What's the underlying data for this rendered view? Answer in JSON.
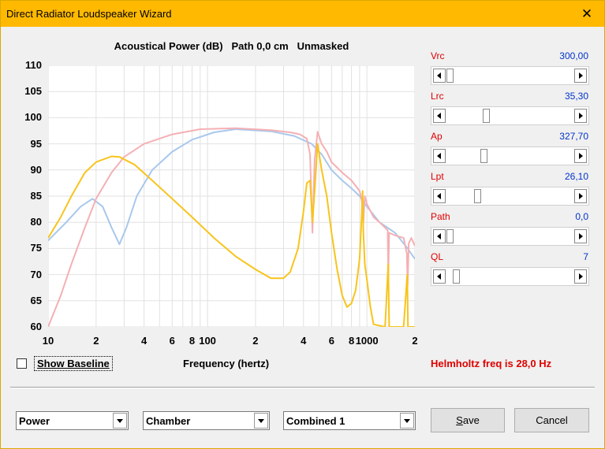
{
  "window": {
    "title": "Direct Radiator Loudspeaker Wizard",
    "close_glyph": "✕"
  },
  "chart_data": {
    "type": "line",
    "title": "Acoustical Power (dB)   Path 0,0 cm   Unmasked",
    "xlabel": "Frequency (hertz)",
    "ylabel": "",
    "x_scale": "log",
    "xlim": [
      10,
      2000
    ],
    "ylim": [
      60,
      110
    ],
    "yticks": [
      110,
      105,
      100,
      95,
      90,
      85,
      80,
      75,
      70,
      65,
      60
    ],
    "xtick_labels": [
      {
        "value": 10,
        "label": "10"
      },
      {
        "value": 20,
        "label": "2"
      },
      {
        "value": 40,
        "label": "4"
      },
      {
        "value": 60,
        "label": "6"
      },
      {
        "value": 80,
        "label": "8"
      },
      {
        "value": 100,
        "label": "100"
      },
      {
        "value": 200,
        "label": "2"
      },
      {
        "value": 400,
        "label": "4"
      },
      {
        "value": 600,
        "label": "6"
      },
      {
        "value": 800,
        "label": "8"
      },
      {
        "value": 1000,
        "label": "1000"
      },
      {
        "value": 2000,
        "label": "2"
      }
    ],
    "grid": true,
    "series": [
      {
        "color": "#a8c8ec",
        "points": [
          [
            10,
            76.5
          ],
          [
            13,
            80
          ],
          [
            16,
            83
          ],
          [
            19,
            84.5
          ],
          [
            22,
            83
          ],
          [
            25,
            79
          ],
          [
            28,
            75.8
          ],
          [
            31,
            79
          ],
          [
            36,
            85
          ],
          [
            45,
            90
          ],
          [
            60,
            93.5
          ],
          [
            80,
            95.8
          ],
          [
            110,
            97.2
          ],
          [
            150,
            97.8
          ],
          [
            250,
            97.4
          ],
          [
            350,
            96.5
          ],
          [
            450,
            95
          ],
          [
            520,
            93
          ],
          [
            600,
            90
          ],
          [
            700,
            88
          ],
          [
            800,
            86.5
          ],
          [
            900,
            85
          ],
          [
            1000,
            83
          ],
          [
            1200,
            80
          ],
          [
            1500,
            78
          ],
          [
            1800,
            75
          ],
          [
            2000,
            73
          ]
        ]
      },
      {
        "color": "#f4b0b4",
        "points": [
          [
            10,
            60
          ],
          [
            12,
            66
          ],
          [
            14,
            72
          ],
          [
            17,
            79
          ],
          [
            20,
            84.5
          ],
          [
            25,
            89.5
          ],
          [
            30,
            92.5
          ],
          [
            40,
            95
          ],
          [
            60,
            96.8
          ],
          [
            90,
            97.8
          ],
          [
            150,
            98
          ],
          [
            250,
            97.6
          ],
          [
            330,
            97.2
          ],
          [
            380,
            96.8
          ],
          [
            420,
            96
          ],
          [
            440,
            93
          ],
          [
            455,
            78
          ],
          [
            470,
            92
          ],
          [
            490,
            97.3
          ],
          [
            520,
            95
          ],
          [
            560,
            93.5
          ],
          [
            600,
            91.5
          ],
          [
            700,
            89.5
          ],
          [
            800,
            88
          ],
          [
            900,
            86
          ],
          [
            930,
            84
          ],
          [
            950,
            80
          ],
          [
            970,
            85
          ],
          [
            1000,
            83.5
          ],
          [
            1100,
            81
          ],
          [
            1200,
            80
          ],
          [
            1350,
            78.5
          ],
          [
            1360,
            70
          ],
          [
            1380,
            78
          ],
          [
            1500,
            77.5
          ],
          [
            1700,
            77
          ],
          [
            1780,
            74
          ],
          [
            1800,
            68
          ],
          [
            1830,
            76
          ],
          [
            1900,
            77
          ],
          [
            2000,
            75.5
          ]
        ]
      },
      {
        "color": "#f8c41c",
        "points": [
          [
            10,
            77
          ],
          [
            12,
            81
          ],
          [
            14,
            85
          ],
          [
            17,
            89.5
          ],
          [
            20,
            91.5
          ],
          [
            25,
            92.6
          ],
          [
            28,
            92.5
          ],
          [
            35,
            91
          ],
          [
            45,
            88
          ],
          [
            60,
            84.5
          ],
          [
            80,
            81
          ],
          [
            110,
            77
          ],
          [
            150,
            73.5
          ],
          [
            200,
            71
          ],
          [
            250,
            69.3
          ],
          [
            300,
            69.3
          ],
          [
            330,
            70.5
          ],
          [
            370,
            75
          ],
          [
            400,
            82
          ],
          [
            420,
            87.5
          ],
          [
            440,
            88
          ],
          [
            455,
            80
          ],
          [
            470,
            86
          ],
          [
            490,
            95
          ],
          [
            520,
            90
          ],
          [
            560,
            85
          ],
          [
            600,
            78
          ],
          [
            650,
            71
          ],
          [
            700,
            66
          ],
          [
            750,
            63.8
          ],
          [
            800,
            64.5
          ],
          [
            850,
            67
          ],
          [
            900,
            73
          ],
          [
            930,
            82
          ],
          [
            940,
            86
          ],
          [
            950,
            78
          ],
          [
            970,
            72
          ],
          [
            1000,
            69
          ],
          [
            1050,
            64
          ],
          [
            1100,
            60.5
          ],
          [
            1300,
            60
          ],
          [
            1360,
            72
          ],
          [
            1380,
            60
          ],
          [
            1700,
            60
          ],
          [
            1790,
            70
          ],
          [
            1810,
            60
          ],
          [
            2000,
            60
          ]
        ]
      }
    ]
  },
  "checkbox": {
    "label": "Show Baseline"
  },
  "helmholtz": "Helmholtz freq is 28,0 Hz",
  "sliders": [
    {
      "label": "Vrc",
      "value": "300,00",
      "position": 0.0
    },
    {
      "label": "Lrc",
      "value": "35,30",
      "position": 0.3
    },
    {
      "label": "Ap",
      "value": "327,70",
      "position": 0.28
    },
    {
      "label": "Lpt",
      "value": "26,10",
      "position": 0.23
    },
    {
      "label": "Path",
      "value": "0,0",
      "position": 0.0
    },
    {
      "label": "QL",
      "value": "7",
      "position": 0.05
    }
  ],
  "dropdowns": {
    "mode": "Power",
    "location": "Chamber",
    "combination": "Combined 1"
  },
  "buttons": {
    "save": "Save",
    "cancel": "Cancel"
  },
  "colors": {
    "titlebar": "#ffb900",
    "label": "#e00000",
    "value": "#0033cc"
  }
}
